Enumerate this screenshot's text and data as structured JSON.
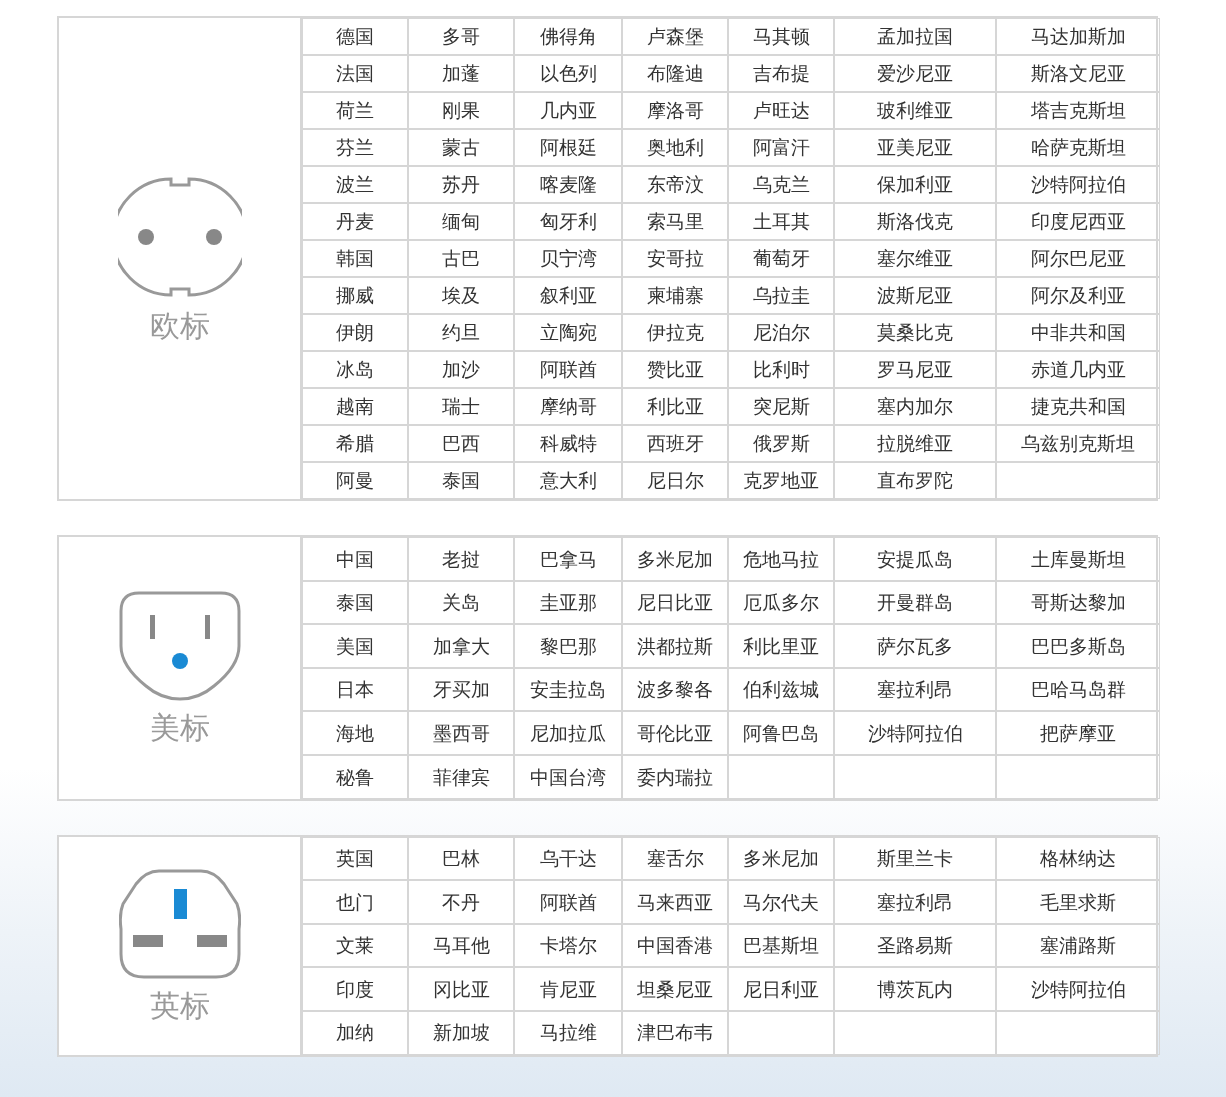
{
  "sections": [
    {
      "label": "欧标",
      "kind": "eu",
      "rows": [
        [
          "德国",
          "多哥",
          "佛得角",
          "卢森堡",
          "马其顿",
          "孟加拉国",
          "马达加斯加"
        ],
        [
          "法国",
          "加蓬",
          "以色列",
          "布隆迪",
          "吉布提",
          "爱沙尼亚",
          "斯洛文尼亚"
        ],
        [
          "荷兰",
          "刚果",
          "几内亚",
          "摩洛哥",
          "卢旺达",
          "玻利维亚",
          "塔吉克斯坦"
        ],
        [
          "芬兰",
          "蒙古",
          "阿根廷",
          "奥地利",
          "阿富汗",
          "亚美尼亚",
          "哈萨克斯坦"
        ],
        [
          "波兰",
          "苏丹",
          "喀麦隆",
          "东帝汶",
          "乌克兰",
          "保加利亚",
          "沙特阿拉伯"
        ],
        [
          "丹麦",
          "缅甸",
          "匈牙利",
          "索马里",
          "土耳其",
          "斯洛伐克",
          "印度尼西亚"
        ],
        [
          "韩国",
          "古巴",
          "贝宁湾",
          "安哥拉",
          "葡萄牙",
          "塞尔维亚",
          "阿尔巴尼亚"
        ],
        [
          "挪威",
          "埃及",
          "叙利亚",
          "柬埔寨",
          "乌拉圭",
          "波斯尼亚",
          "阿尔及利亚"
        ],
        [
          "伊朗",
          "约旦",
          "立陶宛",
          "伊拉克",
          "尼泊尔",
          "莫桑比克",
          "中非共和国"
        ],
        [
          "冰岛",
          "加沙",
          "阿联酋",
          "赞比亚",
          "比利时",
          "罗马尼亚",
          "赤道几内亚"
        ],
        [
          "越南",
          "瑞士",
          "摩纳哥",
          "利比亚",
          "突尼斯",
          "塞内加尔",
          "捷克共和国"
        ],
        [
          "希腊",
          "巴西",
          "科威特",
          "西班牙",
          "俄罗斯",
          "拉脱维亚",
          "乌兹别克斯坦"
        ],
        [
          "阿曼",
          "泰国",
          "意大利",
          "尼日尔",
          "克罗地亚",
          "直布罗陀"
        ]
      ]
    },
    {
      "label": "美标",
      "kind": "us",
      "rows": [
        [
          "中国",
          "老挝",
          "巴拿马",
          "多米尼加",
          "危地马拉",
          "安提瓜岛",
          "土库曼斯坦"
        ],
        [
          "泰国",
          "关岛",
          "圭亚那",
          "尼日比亚",
          "厄瓜多尔",
          "开曼群岛",
          "哥斯达黎加"
        ],
        [
          "美国",
          "加拿大",
          "黎巴那",
          "洪都拉斯",
          "利比里亚",
          "萨尔瓦多",
          "巴巴多斯岛"
        ],
        [
          "日本",
          "牙买加",
          "安圭拉岛",
          "波多黎各",
          "伯利兹城",
          "塞拉利昂",
          "巴哈马岛群"
        ],
        [
          "海地",
          "墨西哥",
          "尼加拉瓜",
          "哥伦比亚",
          "阿鲁巴岛",
          "沙特阿拉伯",
          "把萨摩亚"
        ],
        [
          "秘鲁",
          "菲律宾",
          "中国台湾",
          "委内瑞拉"
        ]
      ]
    },
    {
      "label": "英标",
      "kind": "uk",
      "rows": [
        [
          "英国",
          "巴林",
          "乌干达",
          "塞舌尔",
          "多米尼加",
          "斯里兰卡",
          "格林纳达"
        ],
        [
          "也门",
          "不丹",
          "阿联酋",
          "马来西亚",
          "马尔代夫",
          "塞拉利昂",
          "毛里求斯"
        ],
        [
          "文莱",
          "马耳他",
          "卡塔尔",
          "中国香港",
          "巴基斯坦",
          "圣路易斯",
          "塞浦路斯"
        ],
        [
          "印度",
          "冈比亚",
          "肯尼亚",
          "坦桑尼亚",
          "尼日利亚",
          "博茨瓦内",
          "沙特阿拉伯"
        ],
        [
          "加纳",
          "新加坡",
          "马拉维",
          "津巴布韦"
        ]
      ]
    }
  ]
}
